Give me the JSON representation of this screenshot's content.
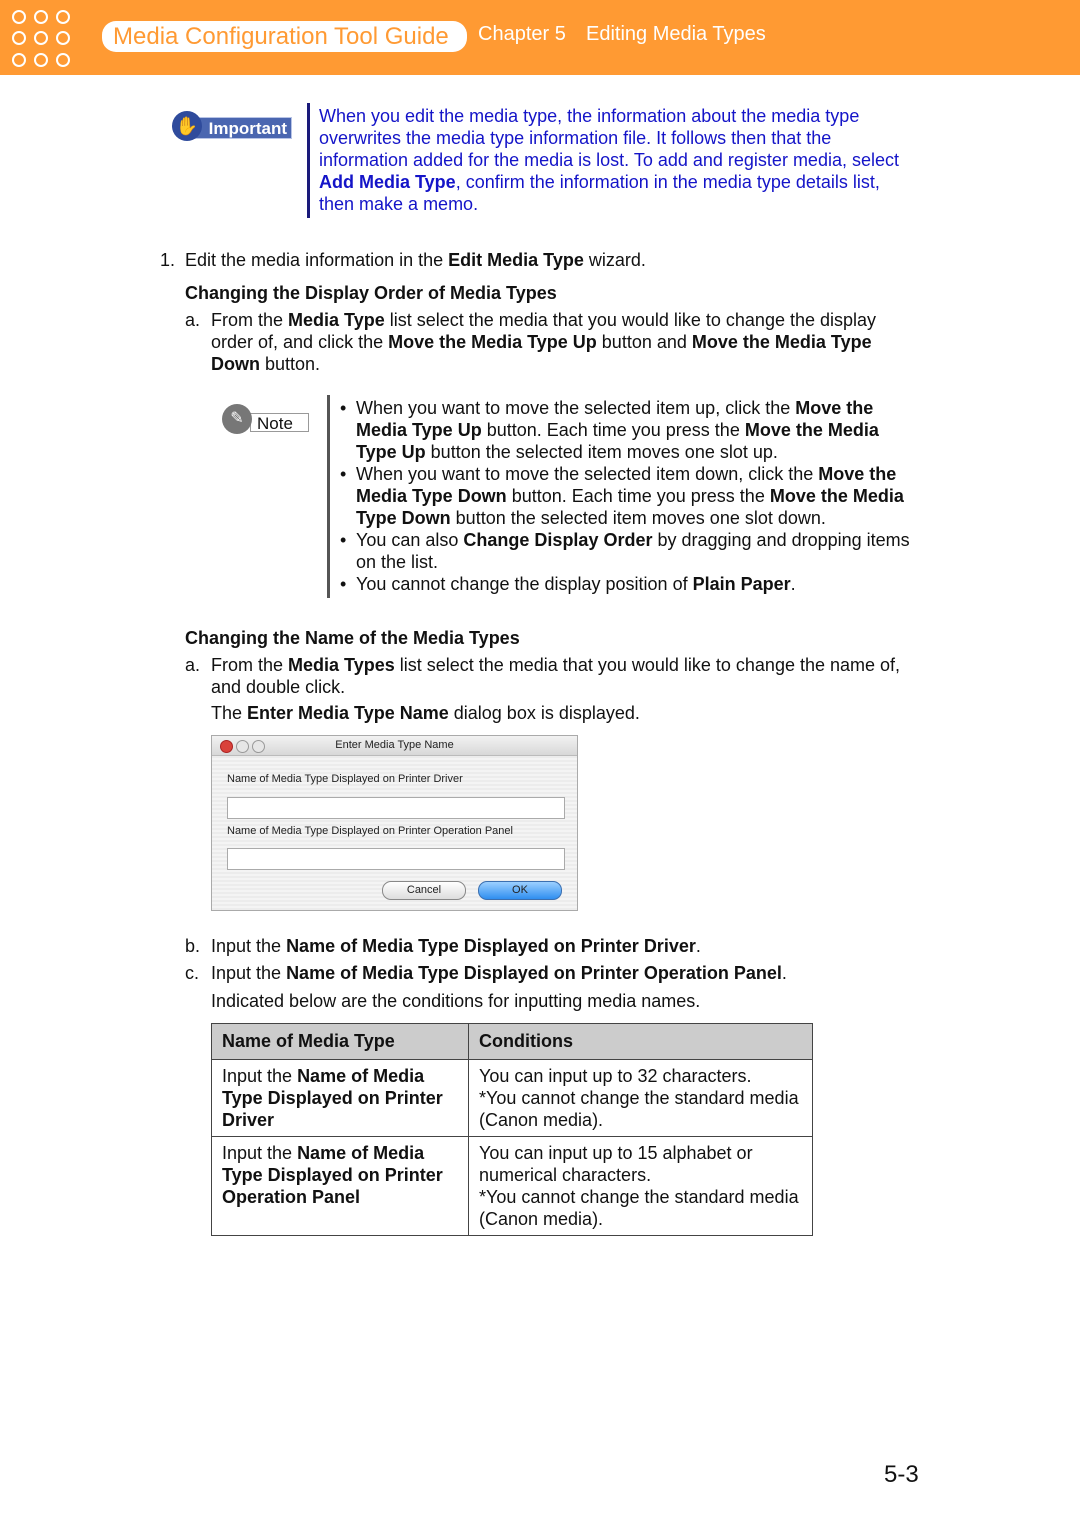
{
  "header": {
    "guide_title": "Media Configuration Tool Guide",
    "chapter": "Chapter 5",
    "section": "Editing Media Types",
    "color": "#FF9A33"
  },
  "important": {
    "label": "Important",
    "text": [
      [
        "When you edit the media type, the information about the media type overwrites the media type information file. It follows then that the information added for the media is lost. To add and register media, select ",
        0
      ],
      [
        "Add Media Type",
        1
      ],
      [
        ", confirm the information in the media type details list, then make a memo.",
        0
      ]
    ]
  },
  "step1": {
    "num": "1.",
    "text": [
      [
        "Edit the media information in the ",
        0
      ],
      [
        "Edit Media Type",
        1
      ],
      [
        " wizard.",
        0
      ]
    ]
  },
  "section1": {
    "heading": "Changing the Display Order of Media Types",
    "a_label": "a.",
    "a_text": [
      [
        "From the ",
        0
      ],
      [
        "Media Type",
        1
      ],
      [
        " list select the media that you would like to change the display order of, and click the ",
        0
      ],
      [
        "Move the Media Type Up",
        1
      ],
      [
        " button and ",
        0
      ],
      [
        "Move the Media Type Down",
        1
      ],
      [
        " button.",
        0
      ]
    ]
  },
  "note": {
    "label": "Note",
    "bullets": [
      [
        [
          "When you want to move the selected item up, click the ",
          0
        ],
        [
          "Move the Media Type Up",
          1
        ],
        [
          " button. Each time you press the ",
          0
        ],
        [
          "Move the Media Type Up",
          1
        ],
        [
          " button the selected item moves one slot up.",
          0
        ]
      ],
      [
        [
          "When you want to move the selected item down, click the ",
          0
        ],
        [
          "Move the Media Type Down",
          1
        ],
        [
          " button. Each time you press the ",
          0
        ],
        [
          "Move the Media Type Down",
          1
        ],
        [
          " button the selected item moves one slot down.",
          0
        ]
      ],
      [
        [
          "You can also ",
          0
        ],
        [
          "Change Display Order",
          1
        ],
        [
          " by dragging and dropping items on the list.",
          0
        ]
      ],
      [
        [
          "You cannot change the display position of ",
          0
        ],
        [
          "Plain Paper",
          1
        ],
        [
          ".",
          0
        ]
      ]
    ]
  },
  "section2": {
    "heading": "Changing the Name of the Media Types",
    "a_label": "a.",
    "a_text": [
      [
        "From the ",
        0
      ],
      [
        "Media Types",
        1
      ],
      [
        " list select the media that you would like to change the name of, and double click.",
        0
      ]
    ],
    "a_text2": [
      [
        "The ",
        0
      ],
      [
        "Enter Media Type Name",
        1
      ],
      [
        " dialog box is displayed.",
        0
      ]
    ],
    "b_label": "b.",
    "b_text": [
      [
        "Input the ",
        0
      ],
      [
        "Name of Media Type Displayed on Printer Driver",
        1
      ],
      [
        ".",
        0
      ]
    ],
    "c_label": "c.",
    "c_text": [
      [
        "Input the ",
        0
      ],
      [
        "Name of Media Type Displayed on Printer Operation Panel",
        1
      ],
      [
        ".",
        0
      ]
    ],
    "c_text2": [
      [
        "Indicated below are the conditions for inputting media names.",
        0
      ]
    ]
  },
  "dialog": {
    "title": "Enter Media Type Name",
    "label1": "Name of Media Type Displayed on Printer Driver",
    "value1": "",
    "label2": "Name of Media Type Displayed on Printer Operation Panel",
    "value2": "",
    "cancel": "Cancel",
    "ok": "OK"
  },
  "table": {
    "headers": [
      "Name of Media Type",
      "Conditions"
    ],
    "rows": [
      {
        "name": [
          [
            "Input the ",
            0
          ],
          [
            "Name of Media Type Displayed on Printer Driver",
            1
          ]
        ],
        "cond": [
          [
            "You can input up to 32 characters.",
            0
          ],
          [
            "\n*You cannot change the standard media (Canon media).",
            0
          ]
        ]
      },
      {
        "name": [
          [
            "Input the ",
            0
          ],
          [
            "Name of Media Type Displayed on Printer Operation Panel",
            1
          ]
        ],
        "cond": [
          [
            "You can input up to 15 alphabet or numerical characters.",
            0
          ],
          [
            "\n*You cannot change the standard media (Canon media).",
            0
          ]
        ]
      }
    ]
  },
  "page_number": "5-3"
}
